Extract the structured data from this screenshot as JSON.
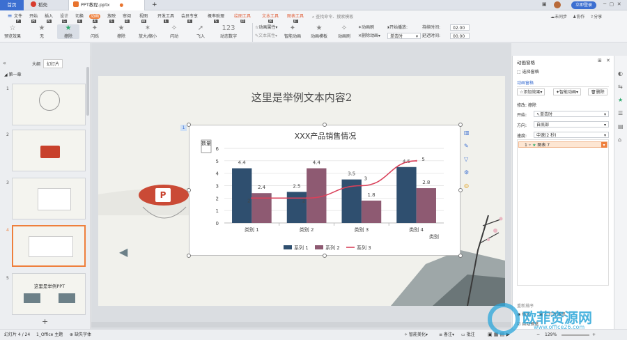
{
  "titlebar": {
    "home_tab": "首页",
    "doc_tab": "稻壳",
    "file_tab": "PPT教程.pptx",
    "new_tab": "+",
    "login": "立即登录"
  },
  "menu": {
    "items": [
      {
        "label": "文件",
        "key": "F"
      },
      {
        "label": "开始",
        "key": "H"
      },
      {
        "label": "插入",
        "key": "N"
      },
      {
        "label": "设计",
        "key": "G"
      },
      {
        "label": "切换",
        "key": "K"
      },
      {
        "label": "动画",
        "key": "A"
      },
      {
        "label": "放映",
        "key": "S"
      },
      {
        "label": "审阅",
        "key": "R"
      },
      {
        "label": "视图",
        "key": "W"
      },
      {
        "label": "开发工具",
        "key": "L"
      },
      {
        "label": "会员专享",
        "key": "K"
      },
      {
        "label": "概率助理",
        "key": "S"
      }
    ],
    "context_items": [
      {
        "label": "绘图工具",
        "key": "JD"
      },
      {
        "label": "文本工具",
        "key": "JX"
      },
      {
        "label": "图表工具",
        "key": "JC"
      }
    ],
    "search": "查找命令、搜索模板",
    "right": [
      "未同步",
      "协作",
      "分享"
    ]
  },
  "ribbon": {
    "buttons": [
      {
        "label": "预览效果",
        "icon": "☆"
      },
      {
        "label": "无",
        "icon": "★"
      },
      {
        "label": "擦除",
        "icon": "★"
      },
      {
        "label": "闪烁",
        "icon": "✦"
      },
      {
        "label": "擦除",
        "icon": "★"
      },
      {
        "label": "放大/缩小",
        "icon": "✶"
      },
      {
        "label": "闪动",
        "icon": "✧"
      },
      {
        "label": "飞入",
        "icon": "➚"
      },
      {
        "label": "动态数字",
        "icon": "123"
      }
    ],
    "anim_attr": "动画属性",
    "text_attr": "文本属性",
    "smart_anim": "智能动画",
    "anim_template": "动画模板",
    "anim_painter": "动画刷",
    "anim_brush": "动画刷",
    "delete_anim": "删除动画",
    "start_play": "开始播放:",
    "start_value": "单击时",
    "duration_label": "持续时间:",
    "duration_value": "02.00",
    "delay_label": "延迟时间:",
    "delay_value": "00.00"
  },
  "leftnav": {
    "tabs": [
      "大纲",
      "幻灯片"
    ],
    "section": "第一章",
    "slide_nums": [
      "1",
      "2",
      "3",
      "4",
      "5"
    ],
    "slide5_title": "这里是举例PPT",
    "add": "+"
  },
  "slide": {
    "title": "这里是举例文本内容2",
    "selection_num": "1"
  },
  "chart_data": {
    "type": "bar",
    "title": "XXX产品销售情况",
    "ylabel": "数量",
    "xlabel": "类别",
    "categories": [
      "类别 1",
      "类别 2",
      "类别 3",
      "类别 4"
    ],
    "ylim": [
      0,
      6
    ],
    "yticks": [
      0,
      1,
      2,
      3,
      4,
      5,
      6
    ],
    "series": [
      {
        "name": "系列 1",
        "type": "bar",
        "color": "#2f4f6f",
        "values": [
          4.4,
          2.5,
          3.5,
          4.5
        ]
      },
      {
        "name": "系列 2",
        "type": "bar",
        "color": "#8e5a72",
        "values": [
          2.4,
          4.4,
          1.8,
          2.8
        ]
      },
      {
        "name": "系列 3",
        "type": "line",
        "color": "#d9415a",
        "values": [
          2,
          2,
          3,
          5
        ]
      }
    ],
    "legend": "bottom"
  },
  "rpane": {
    "title": "动画窗格",
    "select_pane": "选择窗格",
    "section": "动画窗格",
    "add_effect": "添加效果",
    "smart_anim": "智能动画",
    "delete": "删除",
    "modify": "修改: 擦除",
    "start_label": "开始:",
    "start_value": "单击时",
    "dir_label": "方向:",
    "dir_value": "自底部",
    "speed_label": "速度:",
    "speed_value": "中速(2 秒)",
    "item_num": "1",
    "item_label": "图表 7",
    "reorder": "重新排序",
    "play": "播放",
    "slideshow": "幻灯片播放",
    "autopreview": "自动预览"
  },
  "status": {
    "slide_info": "幻灯片 4 / 24",
    "theme": "1_Office 主题",
    "missing_font": "缺失字体",
    "beautify": "智能美化",
    "notes": "备注",
    "comment": "批注",
    "zoom": "129%"
  },
  "watermark": {
    "text": "欧菲资源网",
    "url": "www.office26.com"
  }
}
